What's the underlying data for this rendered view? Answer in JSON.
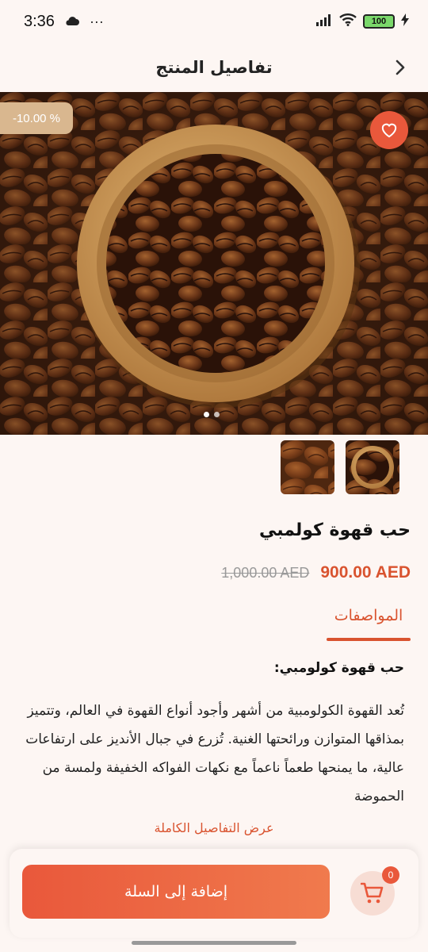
{
  "status_bar": {
    "time": "3:36",
    "extra": "···",
    "battery": "100",
    "icons": [
      "cloud-icon",
      "signal-icon",
      "wifi-icon",
      "battery-icon",
      "charging-icon"
    ]
  },
  "header": {
    "title": "تفاصيل المنتج",
    "back_icon": "chevron-right-icon"
  },
  "gallery": {
    "discount": "-10.00 %",
    "favorite_icon": "heart-icon",
    "page_count": 2,
    "active_page": 1
  },
  "product": {
    "name": "حب قهوة كولمبي",
    "price": "900.00 AED",
    "old_price": "1,000.00 AED"
  },
  "specs": {
    "tab_label": "المواصفات",
    "heading": "حب قهوة كولومبي:",
    "body": "تُعد القهوة الكولومبية من أشهر وأجود أنواع القهوة في العالم، وتتميز بمذاقها المتوازن ورائحتها الغنية. تُزرع في جبال الأنديز على ارتفاعات عالية، ما يمنحها طعماً ناعماً مع نكهات الفواكه الخفيفة ولمسة من الحموضة",
    "more_link": "عرض التفاصيل الكاملة"
  },
  "actions": {
    "add_to_cart": "إضافة إلى السلة",
    "cart_count": "0",
    "cart_icon": "cart-icon"
  },
  "colors": {
    "accent": "#e9583b",
    "price": "#d9532f",
    "badge": "#d9b78f",
    "background": "#fdf6f3"
  }
}
